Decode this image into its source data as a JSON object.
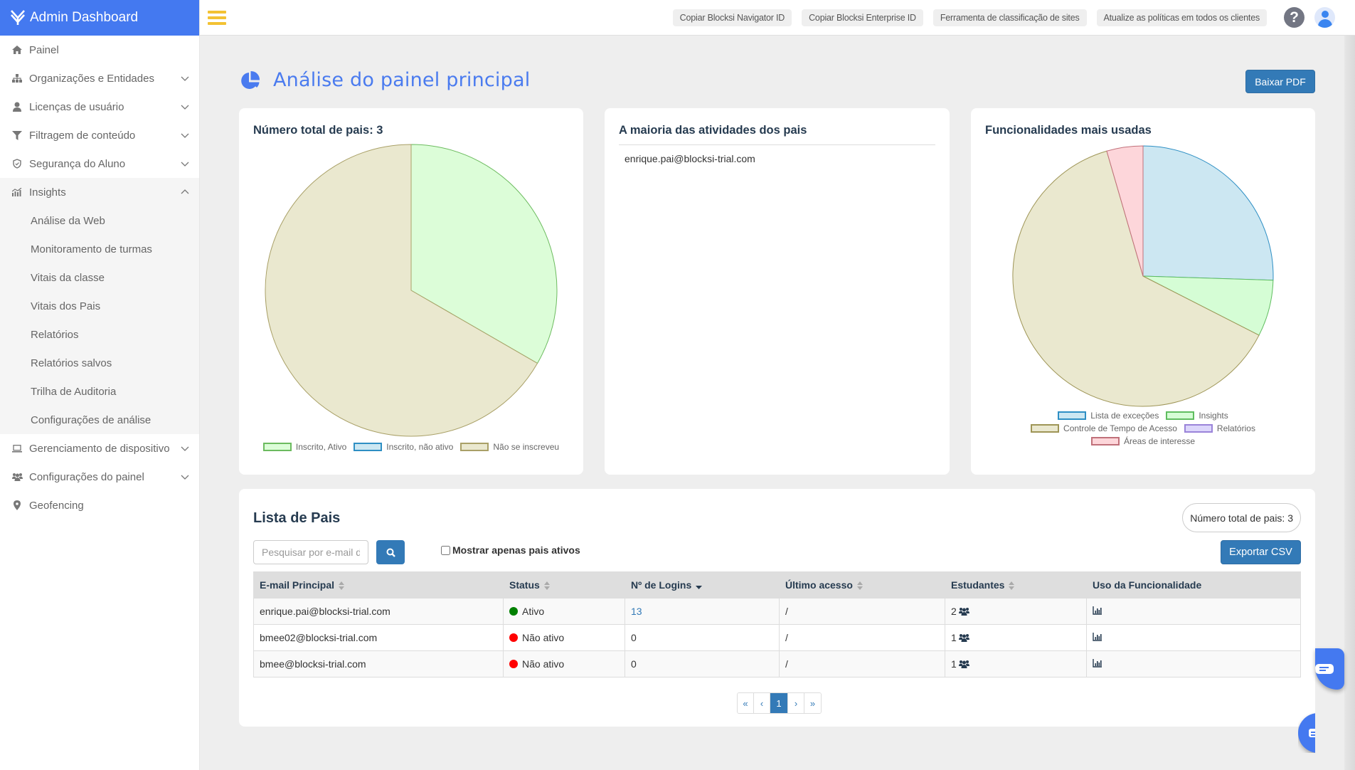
{
  "brand": {
    "title": "Admin Dashboard",
    "logo_icon": "blocksi-logo-icon"
  },
  "sidebar": {
    "items": [
      {
        "label": "Painel",
        "icon": "home-icon",
        "expandable": false
      },
      {
        "label": "Organizações e Entidades",
        "icon": "sitemap-icon",
        "expandable": true
      },
      {
        "label": "Licenças de usuário",
        "icon": "user-icon",
        "expandable": true
      },
      {
        "label": "Filtragem de conteúdo",
        "icon": "filter-icon",
        "expandable": true
      },
      {
        "label": "Segurança do Aluno",
        "icon": "shield-icon",
        "expandable": true
      },
      {
        "label": "Insights",
        "icon": "chart-line-icon",
        "expandable": true,
        "expanded": true
      },
      {
        "label": "Gerenciamento de dispositivo",
        "icon": "laptop-icon",
        "expandable": true
      },
      {
        "label": "Configurações do painel",
        "icon": "users-icon",
        "expandable": true
      },
      {
        "label": "Geofencing",
        "icon": "map-marker-icon",
        "expandable": false
      }
    ],
    "insights_sub": [
      "Análise da Web",
      "Monitoramento de turmas",
      "Vitais da classe",
      "Vitais dos Pais",
      "Relatórios",
      "Relatórios salvos",
      "Trilha de Auditoria",
      "Configurações de análise"
    ]
  },
  "header": {
    "menu_icon": "hamburger-icon",
    "buttons": [
      "Copiar Blocksi Navigator ID",
      "Copiar Blocksi Enterprise ID",
      "Ferramenta de classificação de sites",
      "Atualize as políticas em todos os clientes"
    ],
    "help_label": "?",
    "help_icon": "help-icon",
    "avatar_icon": "user-avatar-icon"
  },
  "page": {
    "title": "Análise do painel principal",
    "title_icon": "pie-chart-icon",
    "download_pdf": "Baixar PDF"
  },
  "activity_card": {
    "title": "A maioria das atividades dos pais",
    "items": [
      "enrique.pai@blocksi-trial.com"
    ]
  },
  "chart_data": [
    {
      "type": "pie",
      "title": "Número total de pais: 3",
      "categories": [
        "Inscrito, Ativo",
        "Inscrito, não ativo",
        "Não se inscreveu"
      ],
      "values": [
        1,
        0,
        2
      ],
      "colors": {
        "fill": [
          "#dcfdd8",
          "#cce7f2",
          "#eae8cf"
        ],
        "stroke": [
          "#6cbb5f",
          "#2e8fc4",
          "#a9a067"
        ]
      },
      "legend": "bottom"
    },
    {
      "type": "pie",
      "title": "Funcionalidades mais usadas",
      "categories": [
        "Lista de exceções",
        "Insights",
        "Controle de Tempo de Acesso",
        "Relatórios",
        "Áreas de interesse"
      ],
      "values": [
        25.5,
        7.0,
        63.0,
        0,
        4.5
      ],
      "value_units": "percent (estimated)",
      "colors": {
        "fill": [
          "#cce7f2",
          "#d5fdd5",
          "#eae8cf",
          "#dcd6fb",
          "#fdd6da"
        ],
        "stroke": [
          "#2e8fc4",
          "#5fbd5f",
          "#9e9556",
          "#9a83d9",
          "#c0707a"
        ]
      },
      "legend": "bottom"
    }
  ],
  "parents_list": {
    "title": "Lista de Pais",
    "total_label": "Número total de pais: 3",
    "search_placeholder": "Pesquisar por e-mail dos pais",
    "search_icon": "search-icon",
    "active_only_label": "Mostrar apenas pais ativos",
    "active_only_checked": false,
    "export_csv": "Exportar CSV",
    "columns": [
      "E-mail Principal",
      "Status",
      "Nº de Logins",
      "Último acesso",
      "Estudantes",
      "Uso da Funcionalidade"
    ],
    "sorted_column": "Nº de Logins",
    "sort_direction": "desc",
    "rows": [
      {
        "email": "enrique.pai@blocksi-trial.com",
        "status": "Ativo",
        "status_color": "#008000",
        "logins": "13",
        "last_access": "/",
        "students": "2",
        "usage_icon": "bar-chart-icon"
      },
      {
        "email": "bmee02@blocksi-trial.com",
        "status": "Não ativo",
        "status_color": "#ff0000",
        "logins": "0",
        "last_access": "/",
        "students": "1",
        "usage_icon": "bar-chart-icon"
      },
      {
        "email": "bmee@blocksi-trial.com",
        "status": "Não ativo",
        "status_color": "#ff0000",
        "logins": "0",
        "last_access": "/",
        "students": "1",
        "usage_icon": "bar-chart-icon"
      }
    ],
    "pagination": {
      "first": "«",
      "prev": "‹",
      "pages": [
        "1"
      ],
      "current": "1",
      "next": "›",
      "last": "»"
    }
  },
  "colors": {
    "brand_blue": "#4479f0",
    "primary_button": "#337ab7",
    "menu_yellow": "#f3c233"
  }
}
